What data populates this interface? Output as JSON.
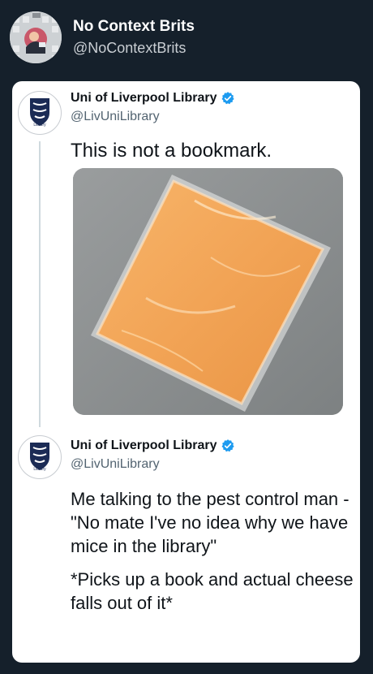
{
  "outer": {
    "name": "No Context Brits",
    "handle": "@NoContextBrits"
  },
  "tweet1": {
    "name": "Uni of Liverpool Library",
    "handle": "@LivUniLibrary",
    "logo_caption": "Library",
    "text": "This is not a bookmark."
  },
  "tweet2": {
    "name": "Uni of Liverpool Library",
    "handle": "@LivUniLibrary",
    "logo_caption": "Library",
    "paragraph1": "Me talking to the pest control man - \"No mate I've no idea why we have mice in the library\"",
    "paragraph2": "*Picks up a book and actual cheese falls out of it*"
  },
  "colors": {
    "background": "#15202b",
    "card": "#ffffff",
    "verified": "#1d9bf0",
    "logo_navy": "#1b2b55",
    "cheese": "#f2a456"
  },
  "icons": {
    "verified": "verified-badge-icon",
    "logo": "university-crest-icon"
  }
}
